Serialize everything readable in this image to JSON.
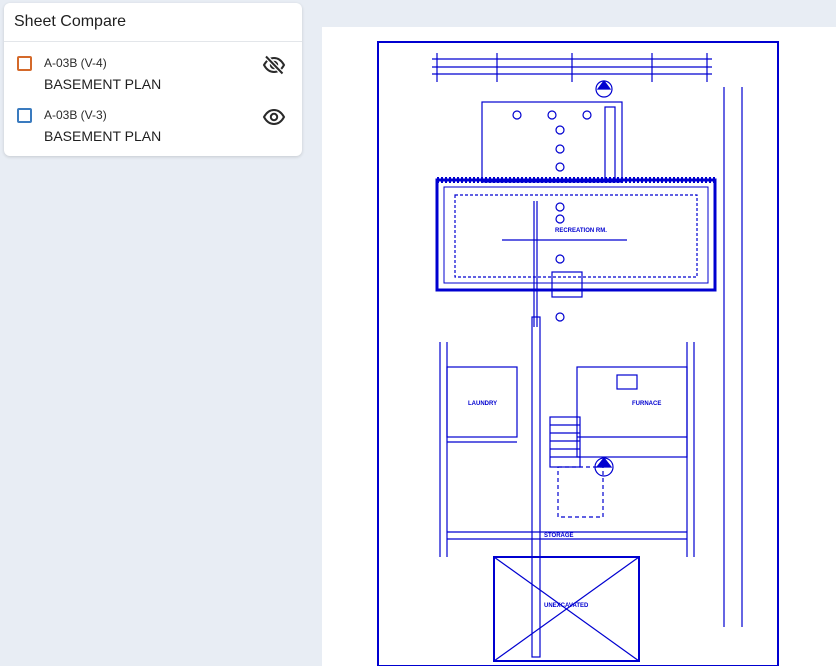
{
  "panel": {
    "title": "Sheet Compare",
    "items": [
      {
        "version": "A-03B (V-4)",
        "name": "BASEMENT PLAN",
        "color": "#d4692a",
        "visibility": "hidden",
        "icon": "eye-off-icon"
      },
      {
        "version": "A-03B (V-3)",
        "name": "BASEMENT PLAN",
        "color": "#3a7bbf",
        "visibility": "visible",
        "icon": "eye-icon"
      }
    ]
  },
  "drawing": {
    "line_color": "#0000d0",
    "labels": {
      "laundry": "LAUNDRY",
      "furnace": "FURNACE",
      "storage": "STORAGE",
      "unexcavated": "UNEXCAVATED",
      "recreation": "RECREATION RM."
    }
  }
}
